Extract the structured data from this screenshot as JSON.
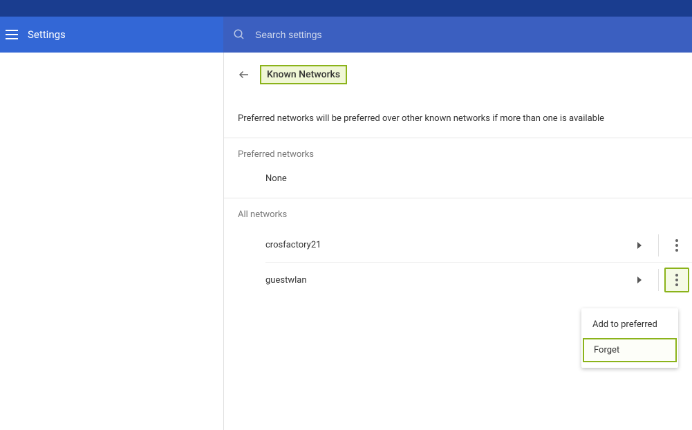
{
  "header": {
    "title": "Settings",
    "search_placeholder": "Search settings"
  },
  "page": {
    "title": "Known Networks",
    "description": "Preferred networks will be preferred over other known networks if more than one is available"
  },
  "sections": {
    "preferred_label": "Preferred networks",
    "preferred_none": "None",
    "all_label": "All networks"
  },
  "networks": [
    {
      "name": "crosfactory21",
      "menu_open": false
    },
    {
      "name": "guestwlan",
      "menu_open": true
    }
  ],
  "context_menu": {
    "add_to_preferred": "Add to preferred",
    "forget": "Forget"
  }
}
